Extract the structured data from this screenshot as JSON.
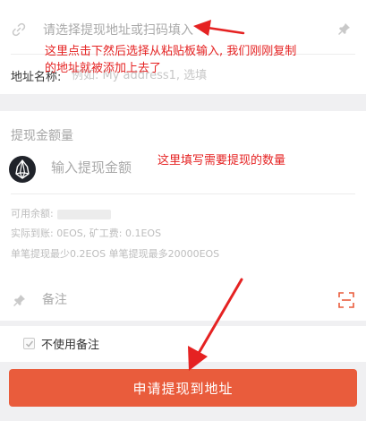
{
  "address_section": {
    "address_placeholder": "请选择提现地址或扫码填入",
    "address_name_label": "地址名称:",
    "address_name_placeholder": "例如: My address1, 选填"
  },
  "amount_section": {
    "title": "提现金额量",
    "amount_placeholder": "输入提现金额",
    "available_label": "可用余额:",
    "actual_receive": "实际到账: 0EOS, 矿工费: 0.1EOS",
    "limits": "单笔提现最少0.2EOS   单笔提现最多20000EOS"
  },
  "memo_section": {
    "memo_placeholder": "备注"
  },
  "checkbox_section": {
    "label": "不使用备注",
    "checked": true
  },
  "submit_button": {
    "label": "申请提现到地址"
  },
  "annotations": {
    "address_note_line1": "这里点击下然后选择从粘贴板输入, 我们刚刚复制",
    "address_note_line2": "的地址就被添加上去了",
    "amount_note": "这里填写需要提现的数量"
  },
  "colors": {
    "accent": "#e95c3c",
    "annotation": "#e52222"
  },
  "icons": {
    "address": "link-icon",
    "address_right": "pin-icon",
    "currency": "eos-icon",
    "memo": "pin-icon",
    "scan": "scan-icon"
  }
}
